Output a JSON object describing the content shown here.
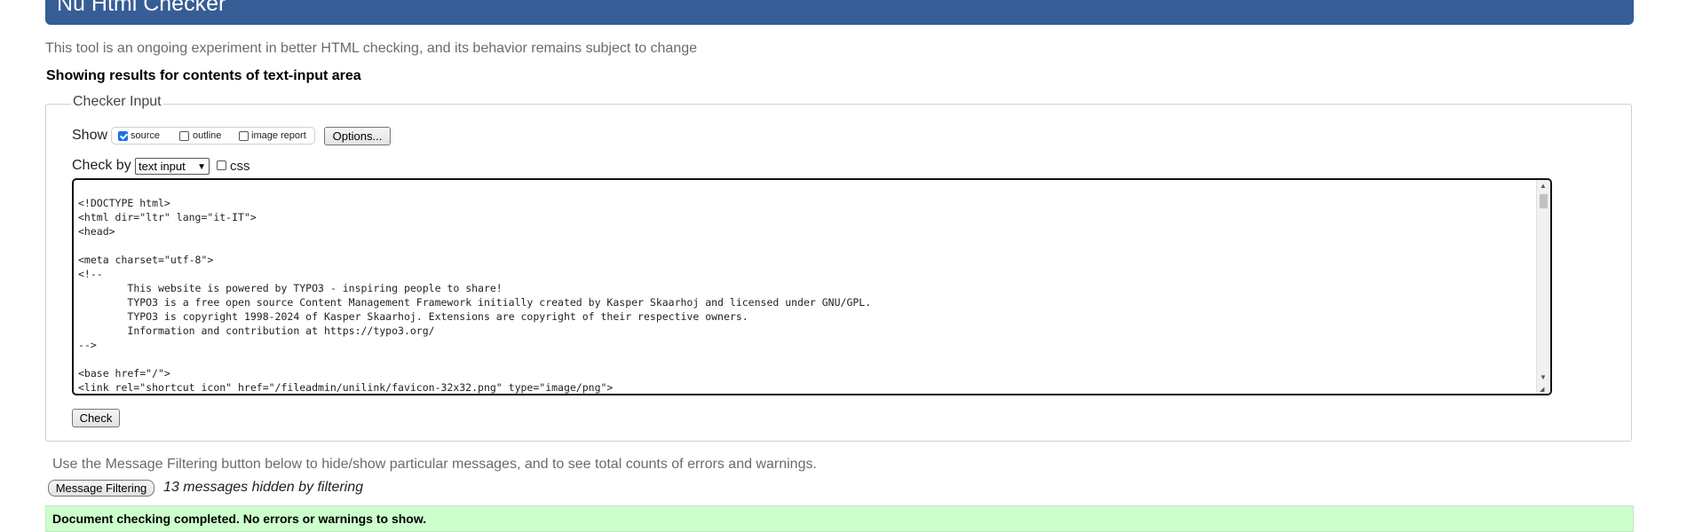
{
  "header": {
    "title": "Nu Html Checker"
  },
  "intro_text": "This tool is an ongoing experiment in better HTML checking, and its behavior remains subject to change",
  "showing_results": "Showing results for contents of text-input area",
  "checker_input": {
    "legend": "Checker Input",
    "show_label": "Show",
    "show_options": [
      {
        "label": "source",
        "checked": true
      },
      {
        "label": "outline",
        "checked": false
      },
      {
        "label": "image report",
        "checked": false
      }
    ],
    "options_button": "Options...",
    "check_by_label": "Check by",
    "check_by_value": "text input",
    "css_label": "css",
    "css_checked": false,
    "source": "<!DOCTYPE html>\n<html dir=\"ltr\" lang=\"it-IT\">\n<head>\n\n<meta charset=\"utf-8\">\n<!--\n\tThis website is powered by TYPO3 - inspiring people to share!\n\tTYPO3 is a free open source Content Management Framework initially created by Kasper Skaarhoj and licensed under GNU/GPL.\n\tTYPO3 is copyright 1998-2024 of Kasper Skaarhoj. Extensions are copyright of their respective owners.\n\tInformation and contribution at https://typo3.org/\n-->\n\n<base href=\"/\">\n<link rel=\"shortcut icon\" href=\"/fileadmin/unilink/favicon-32x32.png\" type=\"image/png\">",
    "check_button": "Check"
  },
  "filtering": {
    "info_text": "Use the Message Filtering button below to hide/show particular messages, and to see total counts of errors and warnings.",
    "button_label": "Message Filtering",
    "hidden_text": "13 messages hidden by filtering"
  },
  "result": {
    "text": "Document checking completed. No errors or warnings to show."
  },
  "colors": {
    "header_bg": "#365d95",
    "success_bg": "#ccffcc",
    "checkbox_checked": "#1a73e8"
  }
}
